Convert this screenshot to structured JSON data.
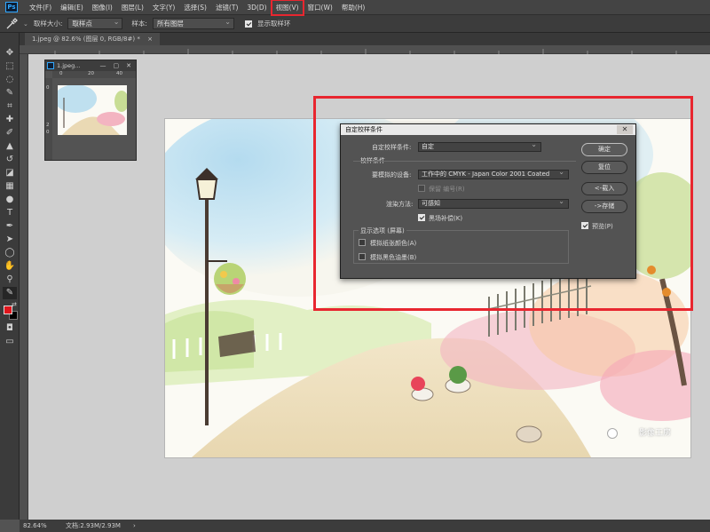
{
  "menu": {
    "app_logo": "Ps",
    "items": [
      "文件(F)",
      "编辑(E)",
      "图像(I)",
      "图层(L)",
      "文字(Y)",
      "选择(S)",
      "滤镜(T)",
      "3D(D)",
      "视图(V)",
      "窗口(W)",
      "帮助(H)"
    ],
    "highlighted_index": 8
  },
  "options": {
    "sample_size_label": "取样大小:",
    "sample_size_value": "取样点",
    "sample_label": "样本:",
    "sample_value": "所有图层",
    "show_ring_label": "显示取样环",
    "show_ring_checked": true
  },
  "doc_tab": {
    "title": "1.jpeg @ 82.6% (图层 0, RGB/8#) *",
    "close": "×"
  },
  "mini_window": {
    "title": "1.jpeg...",
    "ruler_top": [
      "0",
      "20",
      "40"
    ],
    "ruler_left": [
      "0",
      "2",
      "0"
    ]
  },
  "dialog": {
    "title": "自定校样条件",
    "close": "✕",
    "custom_condition_label": "自定校样条件:",
    "custom_condition_value": "自定",
    "proof_conditions_title": "校样条件",
    "device_label": "要模拟的设备:",
    "device_value": "工作中的 CMYK - Japan Color 2001 Coated",
    "preserve_numbers_label": "保留 编号(R)",
    "intent_label": "渲染方法:",
    "intent_value": "可感知",
    "black_point_label": "黑场补偿(K)",
    "black_point_checked": true,
    "display_options_title": "显示选项 (屏幕)",
    "simulate_paper_label": "模拟纸张颜色(A)",
    "simulate_black_label": "模拟黑色油墨(B)",
    "buttons": {
      "ok": "确定",
      "reset": "复位",
      "load": "<-载入",
      "save": "->存储"
    },
    "preview_label": "预览(P)",
    "preview_checked": true
  },
  "status": {
    "zoom": "82.64%",
    "doc_info": "文档:2.93M/2.93M",
    "arrow": "›"
  },
  "watermark": "影像工房",
  "colors": {
    "foreground": "#e0151c",
    "background": "#000000",
    "highlight": "#e8262f"
  }
}
